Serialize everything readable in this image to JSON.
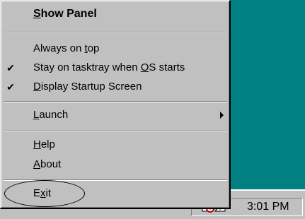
{
  "menu": {
    "show_panel": {
      "before": "",
      "key": "S",
      "after": "how Panel"
    },
    "always_on_top": {
      "before": "Always on ",
      "key": "t",
      "after": "op"
    },
    "stay_on_tray": {
      "before": "Stay on tasktray when ",
      "key": "O",
      "after": "S starts",
      "checked": true
    },
    "display_startup": {
      "before": "",
      "key": "D",
      "after": "isplay Startup Screen",
      "checked": true
    },
    "launch": {
      "before": "",
      "key": "L",
      "after": "aunch"
    },
    "help": {
      "before": "",
      "key": "H",
      "after": "elp"
    },
    "about": {
      "before": "",
      "key": "A",
      "after": "bout"
    },
    "exit": {
      "before": "E",
      "key": "x",
      "after": "it"
    },
    "check_glyph": "✔"
  },
  "taskbar": {
    "clock": "3:01 PM",
    "tray_icon": "app-tray-icon"
  },
  "colors": {
    "desktop": "#008080",
    "menu_face": "#c0c0c0"
  }
}
